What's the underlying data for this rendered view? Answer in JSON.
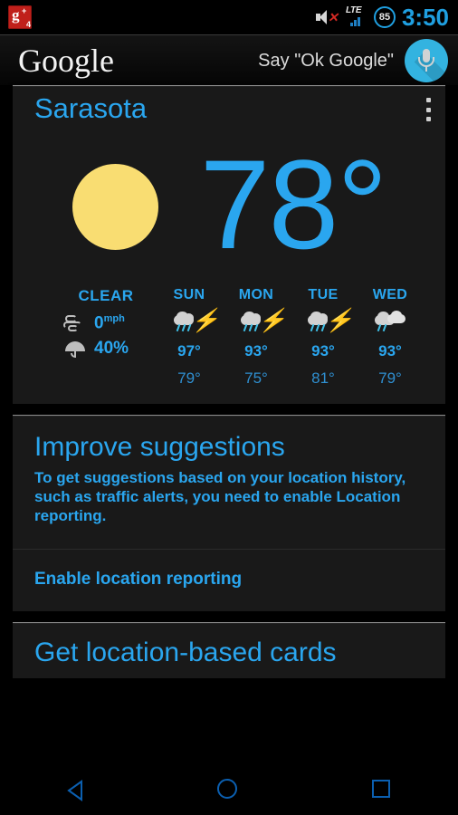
{
  "statusbar": {
    "notification_icon": "google-plus-icon",
    "notification_letter": "g",
    "notification_plus": "+",
    "notification_count": "4",
    "mute_icon": "speaker-muted-icon",
    "network_label": "LTE",
    "battery_level": "85",
    "time": "3:50"
  },
  "searchbar": {
    "logo": "Google",
    "hint": "Say \"Ok Google\"",
    "mic_icon": "microphone-icon"
  },
  "weather_card": {
    "city": "Sarasota",
    "overflow_icon": "overflow-menu-icon",
    "condition_icon": "sun-icon",
    "temperature": "78°",
    "condition": "CLEAR",
    "wind_icon": "wind-icon",
    "wind_value": "0",
    "wind_unit": "mph",
    "precip_icon": "umbrella-icon",
    "precip_value": "40%",
    "forecast": [
      {
        "day": "SUN",
        "icon": "thunderstorm-icon",
        "high": "97°",
        "low": "79°"
      },
      {
        "day": "MON",
        "icon": "thunderstorm-icon",
        "high": "93°",
        "low": "75°"
      },
      {
        "day": "TUE",
        "icon": "thunderstorm-icon",
        "high": "93°",
        "low": "81°"
      },
      {
        "day": "WED",
        "icon": "showers-icon",
        "high": "93°",
        "low": "79°"
      }
    ]
  },
  "suggestion_card": {
    "title": "Improve suggestions",
    "body": "To get suggestions based on your location history, such as traffic alerts, you need to enable Location reporting.",
    "action": "Enable location reporting"
  },
  "partial_card": {
    "title": "Get location-based cards"
  },
  "navbar": {
    "back_icon": "back-triangle-icon",
    "home_icon": "home-circle-icon",
    "recents_icon": "recents-square-icon"
  },
  "colors": {
    "accent_blue": "#2aa6ef",
    "status_blue": "#1f9fe0",
    "mic_blue": "#33b3e0",
    "sun_yellow": "#f9dd72",
    "card_bg": "#191919",
    "screen_bg": "#000000",
    "nav_blue": "#0b5fb0",
    "gplus_red": "#c0201b"
  }
}
